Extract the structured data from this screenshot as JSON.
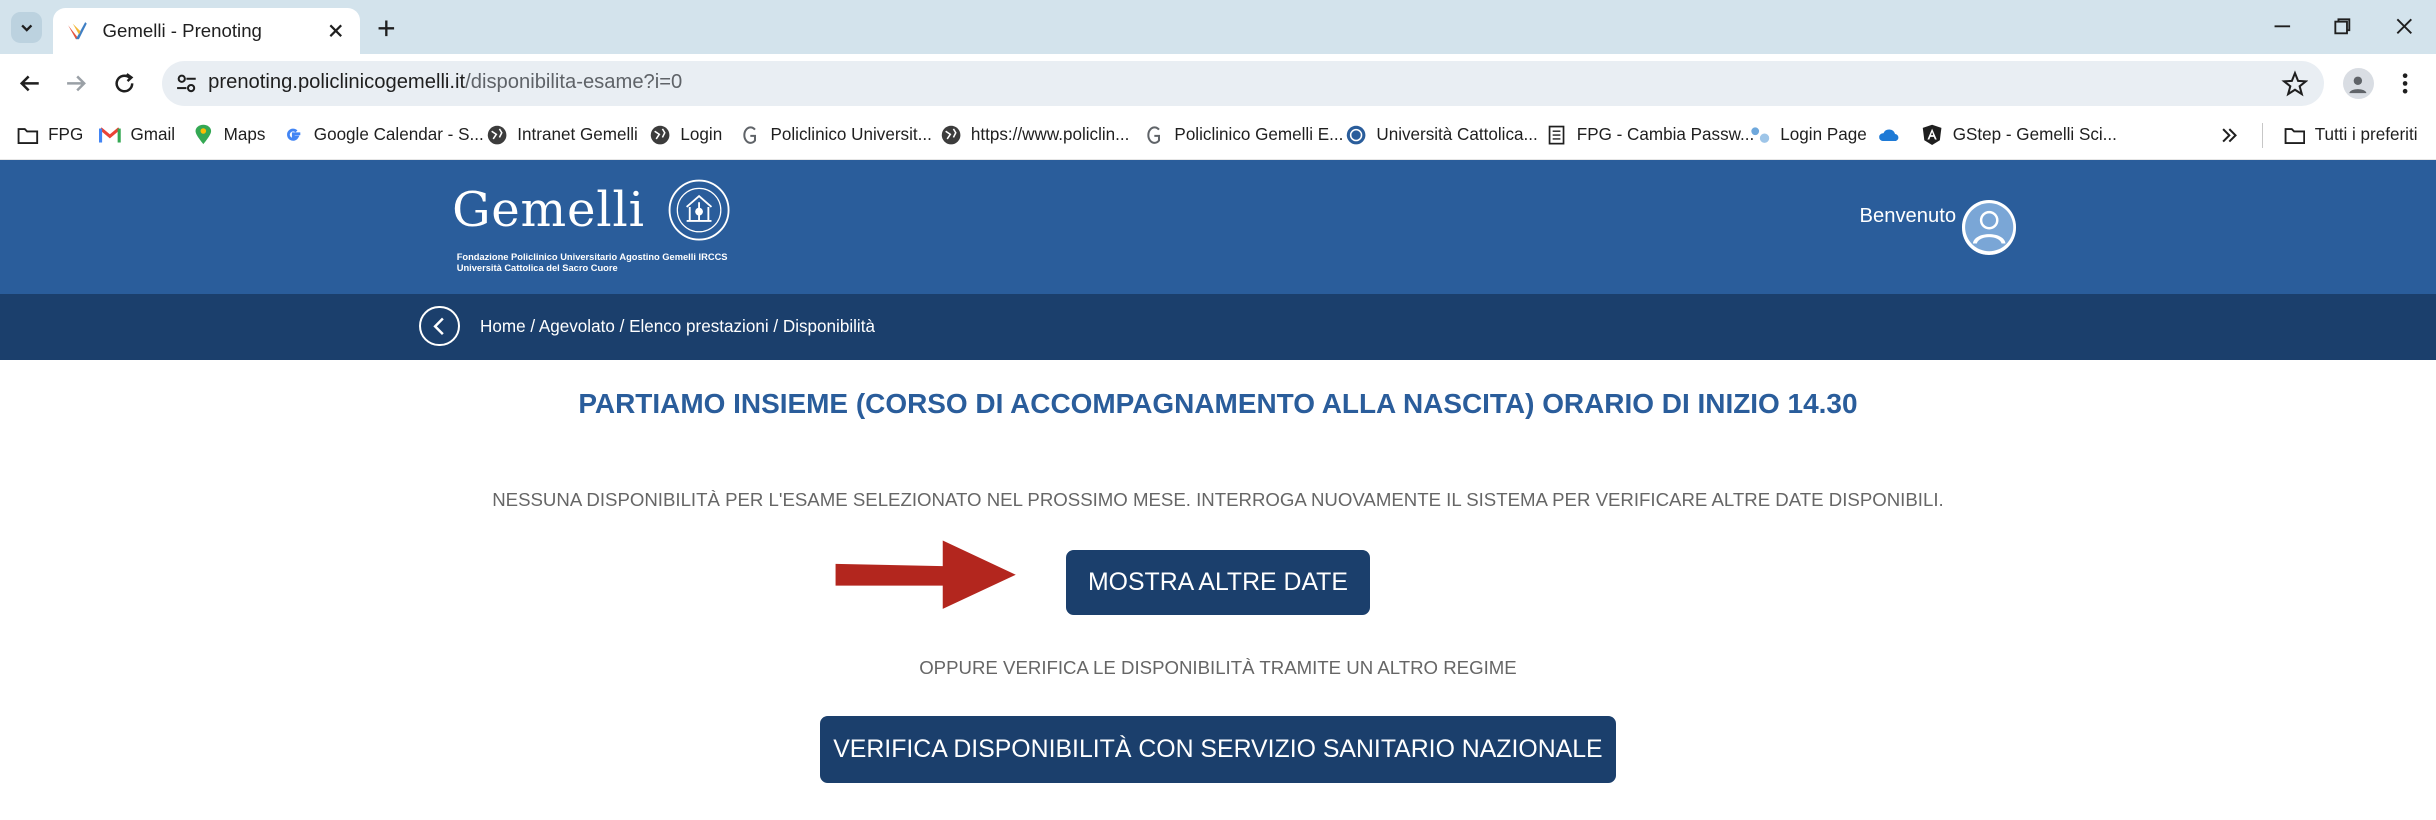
{
  "browser": {
    "tab_title": "Gemelli - Prenoting",
    "url_host": "prenoting.policlinicogemelli.it",
    "url_path": "/disponibilita-esame?i=0",
    "bookmarks": [
      {
        "label": "FPG",
        "icon": "folder-icon"
      },
      {
        "label": "Gmail",
        "icon": "gmail-icon"
      },
      {
        "label": "Maps",
        "icon": "maps-icon"
      },
      {
        "label": "Google Calendar - S...",
        "icon": "google-icon"
      },
      {
        "label": "Intranet Gemelli",
        "icon": "globe-icon"
      },
      {
        "label": "Login",
        "icon": "globe-icon"
      },
      {
        "label": "Policlinico Universit...",
        "icon": "gemelli-icon"
      },
      {
        "label": "https://www.policlin...",
        "icon": "globe-icon"
      },
      {
        "label": "Policlinico Gemelli E...",
        "icon": "gemelli-icon"
      },
      {
        "label": "Università Cattolica...",
        "icon": "seal-icon"
      },
      {
        "label": "FPG - Cambia Passw...",
        "icon": "page-icon"
      },
      {
        "label": "Login Page",
        "icon": "login-icon"
      },
      {
        "label": "",
        "icon": "cloud-icon"
      },
      {
        "label": "GStep - Gemelli Sci...",
        "icon": "angular-icon"
      }
    ],
    "all_bookmarks_label": "Tutti i preferiti"
  },
  "header": {
    "logo_text": "Gemelli",
    "logo_sub_line1": "Fondazione Policlinico Universitario Agostino Gemelli IRCCS",
    "logo_sub_line2": "Università Cattolica del Sacro Cuore",
    "welcome": "Benvenuto"
  },
  "breadcrumb": {
    "text": "Home / Agevolato / Elenco prestazioni / Disponibilità"
  },
  "main": {
    "title": "PARTIAMO INSIEME (CORSO DI ACCOMPAGNAMENTO ALLA NASCITA) ORARIO DI INIZIO 14.30",
    "notice": "NESSUNA DISPONIBILITÀ PER L'ESAME SELEZIONATO NEL PROSSIMO MESE. INTERROGA NUOVAMENTE IL SISTEMA PER VERIFICARE ALTRE DATE DISPONIBILI.",
    "show_dates_button": "MOSTRA ALTRE DATE",
    "or_text": "OPPURE VERIFICA LE DISPONIBILITÀ TRAMITE UN ALTRO REGIME",
    "ssn_button": "VERIFICA DISPONIBILITÀ CON SERVIZIO SANITARIO NAZIONALE"
  },
  "colors": {
    "header_blue": "#2a5d9b",
    "dark_navy": "#1b3f6c",
    "arrow_red": "#b3261e"
  }
}
